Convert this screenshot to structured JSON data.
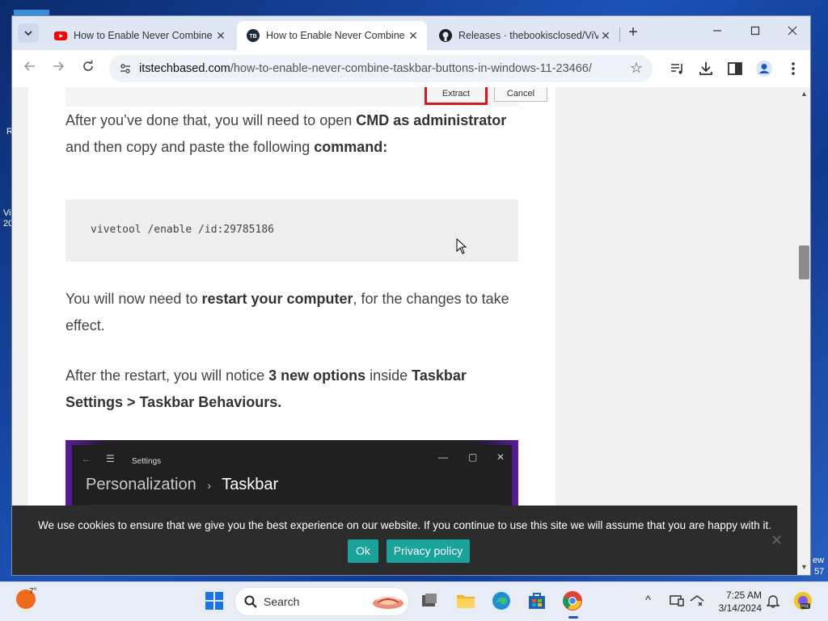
{
  "desktop": {
    "left_fragments": [
      "R",
      "Vi",
      "20"
    ],
    "right_fragments": [
      "ew",
      "57"
    ]
  },
  "tabs": [
    {
      "title": "How to Enable Never Combine",
      "favicon": "youtube-icon",
      "active": false
    },
    {
      "title": "How to Enable Never Combine",
      "favicon": "site-logo-icon",
      "active": true
    },
    {
      "title": "Releases · thebookisclosed/ViVe",
      "favicon": "github-icon",
      "active": false
    }
  ],
  "toolbar": {
    "url_host": "itstechbased.com",
    "url_path": "/how-to-enable-never-combine-taskbar-buttons-in-windows-11-23466/"
  },
  "article": {
    "extract_label": "Extract",
    "cancel_label": "Cancel",
    "p1": {
      "t1": "After you’ve done that, you will need to open ",
      "b1": "CMD as administrator",
      "t2": " and then copy and paste the following ",
      "b2": "command:"
    },
    "code": "vivetool /enable /id:29785186",
    "p2": {
      "t1": "You will now need to ",
      "b1": "restart your computer",
      "t2": ", for the changes to take effect."
    },
    "p3": {
      "t1": "After the restart, you will notice ",
      "b1": "3 new options",
      "t2": " inside ",
      "b2": "Taskbar Settings > Taskbar Behaviours."
    },
    "settings_shot": {
      "window_title": "Settings",
      "crumb_parent": "Personalization",
      "crumb_sep": "›",
      "crumb_current": "Taskbar"
    }
  },
  "cookie": {
    "text": "We use cookies to ensure that we give you the best experience on our website. If you continue to use this site we will assume that you are happy with it.",
    "ok_label": "Ok",
    "privacy_label": "Privacy policy"
  },
  "taskbar": {
    "temperature": "7°",
    "search_label": "Search",
    "time": "7:25 AM",
    "date": "3/14/2024"
  },
  "colors": {
    "accent_teal": "#1aa39a",
    "highlight_red": "#d7181f",
    "tab_strip": "#dfe7f5"
  }
}
